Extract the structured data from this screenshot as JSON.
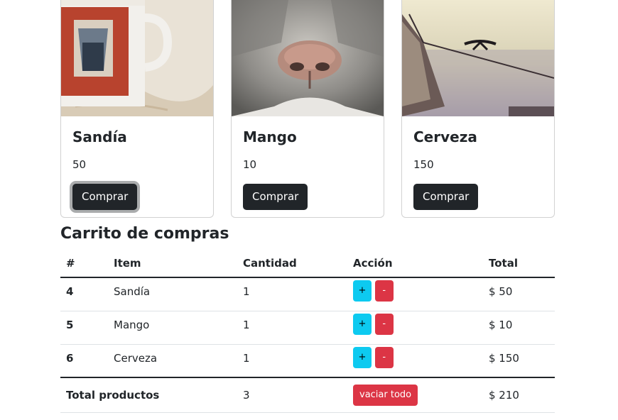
{
  "products": [
    {
      "name": "Sandía",
      "price": "50",
      "button": "Comprar",
      "image": "mug-stamp-photo"
    },
    {
      "name": "Mango",
      "price": "10",
      "button": "Comprar",
      "image": "cat-nose-photo"
    },
    {
      "name": "Cerveza",
      "price": "150",
      "button": "Comprar",
      "image": "boat-bird-photo"
    }
  ],
  "cart": {
    "title": "Carrito de compras",
    "headers": {
      "id": "#",
      "item": "Item",
      "qty": "Cantidad",
      "action": "Acción",
      "total": "Total"
    },
    "rows": [
      {
        "id": "4",
        "item": "Sandía",
        "qty": "1",
        "plus": "+",
        "minus": "-",
        "total": "$ 50"
      },
      {
        "id": "5",
        "item": "Mango",
        "qty": "1",
        "plus": "+",
        "minus": "-",
        "total": "$ 10"
      },
      {
        "id": "6",
        "item": "Cerveza",
        "qty": "1",
        "plus": "+",
        "minus": "-",
        "total": "$ 150"
      }
    ],
    "footer": {
      "label": "Total productos",
      "qty": "3",
      "clear_button": "vaciar todo",
      "total": "$ 210"
    }
  },
  "colors": {
    "dark": "#212529",
    "info": "#0dcaf0",
    "danger": "#dc3545"
  }
}
